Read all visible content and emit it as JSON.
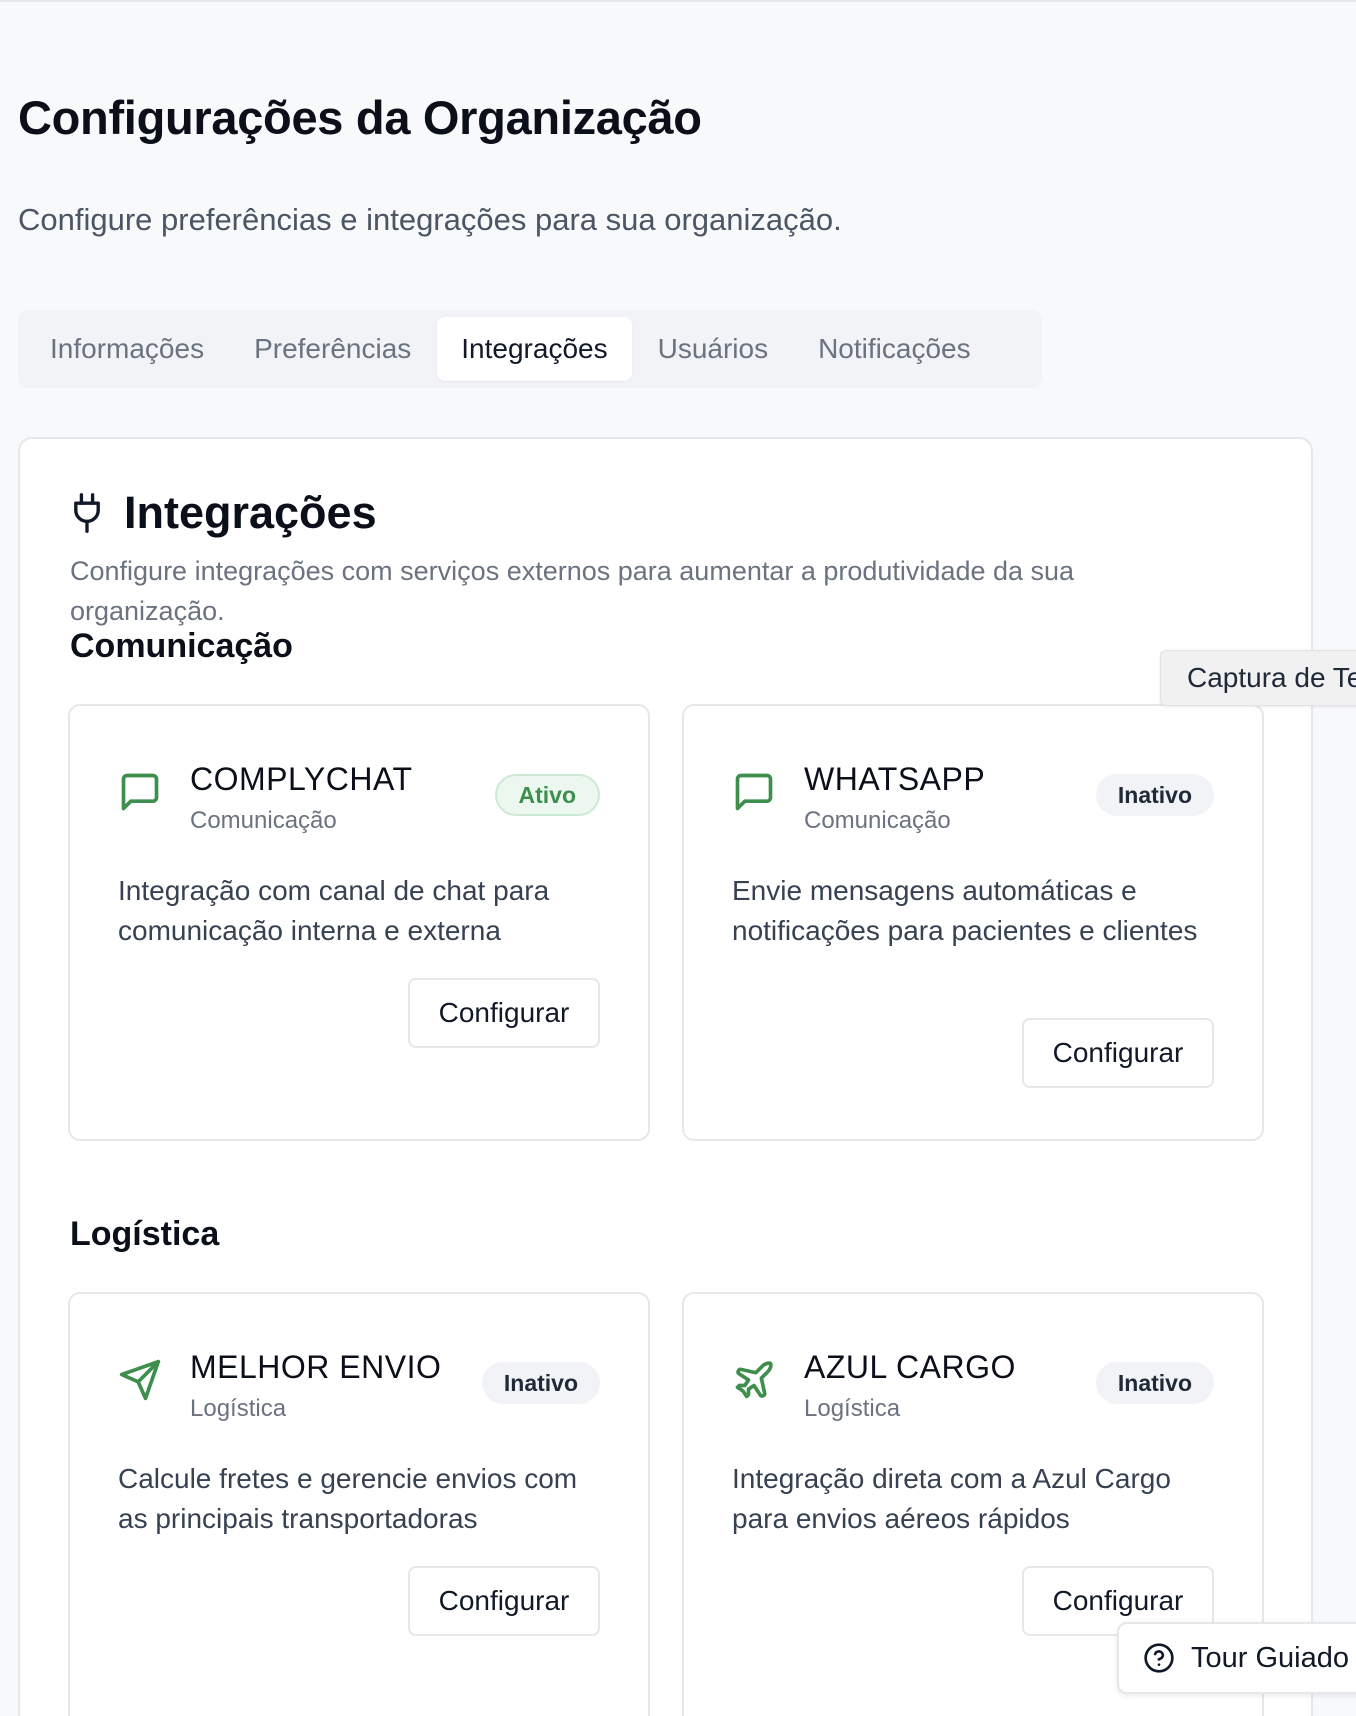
{
  "page": {
    "title": "Configurações da Organização",
    "subtitle": "Configure preferências e integrações para sua organização."
  },
  "tabs": [
    {
      "label": "Informações",
      "active": false
    },
    {
      "label": "Preferências",
      "active": false
    },
    {
      "label": "Integrações",
      "active": true
    },
    {
      "label": "Usuários",
      "active": false
    },
    {
      "label": "Notificações",
      "active": false
    }
  ],
  "integrations": {
    "icon": "plug-icon",
    "title": "Integrações",
    "description": "Configure integrações com serviços externos para aumentar a produtividade da sua organização.",
    "groups": [
      {
        "title": "Comunicação",
        "items": [
          {
            "name": "COMPLYCHAT",
            "category": "Comunicação",
            "status": "Ativo",
            "icon": "message-square-icon",
            "description": "Integração com canal de chat para comunicação interna e externa",
            "button": "Configurar"
          },
          {
            "name": "WHATSAPP",
            "category": "Comunicação",
            "status": "Inativo",
            "icon": "message-square-icon",
            "description": "Envie mensagens automáticas e notificações para pacientes e clientes",
            "button": "Configurar"
          }
        ]
      },
      {
        "title": "Logística",
        "items": [
          {
            "name": "MELHOR ENVIO",
            "category": "Logística",
            "status": "Inativo",
            "icon": "send-icon",
            "description": "Calcule fretes e gerencie envios com as principais transportadoras",
            "button": "Configurar"
          },
          {
            "name": "AZUL CARGO",
            "category": "Logística",
            "status": "Inativo",
            "icon": "plane-icon",
            "description": "Integração direta com a Azul Cargo para envios aéreos rápidos",
            "button": "Configurar"
          }
        ]
      }
    ]
  },
  "floating": {
    "capture_label": "Captura de Tela",
    "tour_label": "Tour Guiado",
    "tour_icon": "help-circle-icon"
  },
  "colors": {
    "accent_green": "#3e8e4e",
    "active_badge_bg": "#ecf8ef",
    "inactive_badge_bg": "#f1f3f6"
  }
}
